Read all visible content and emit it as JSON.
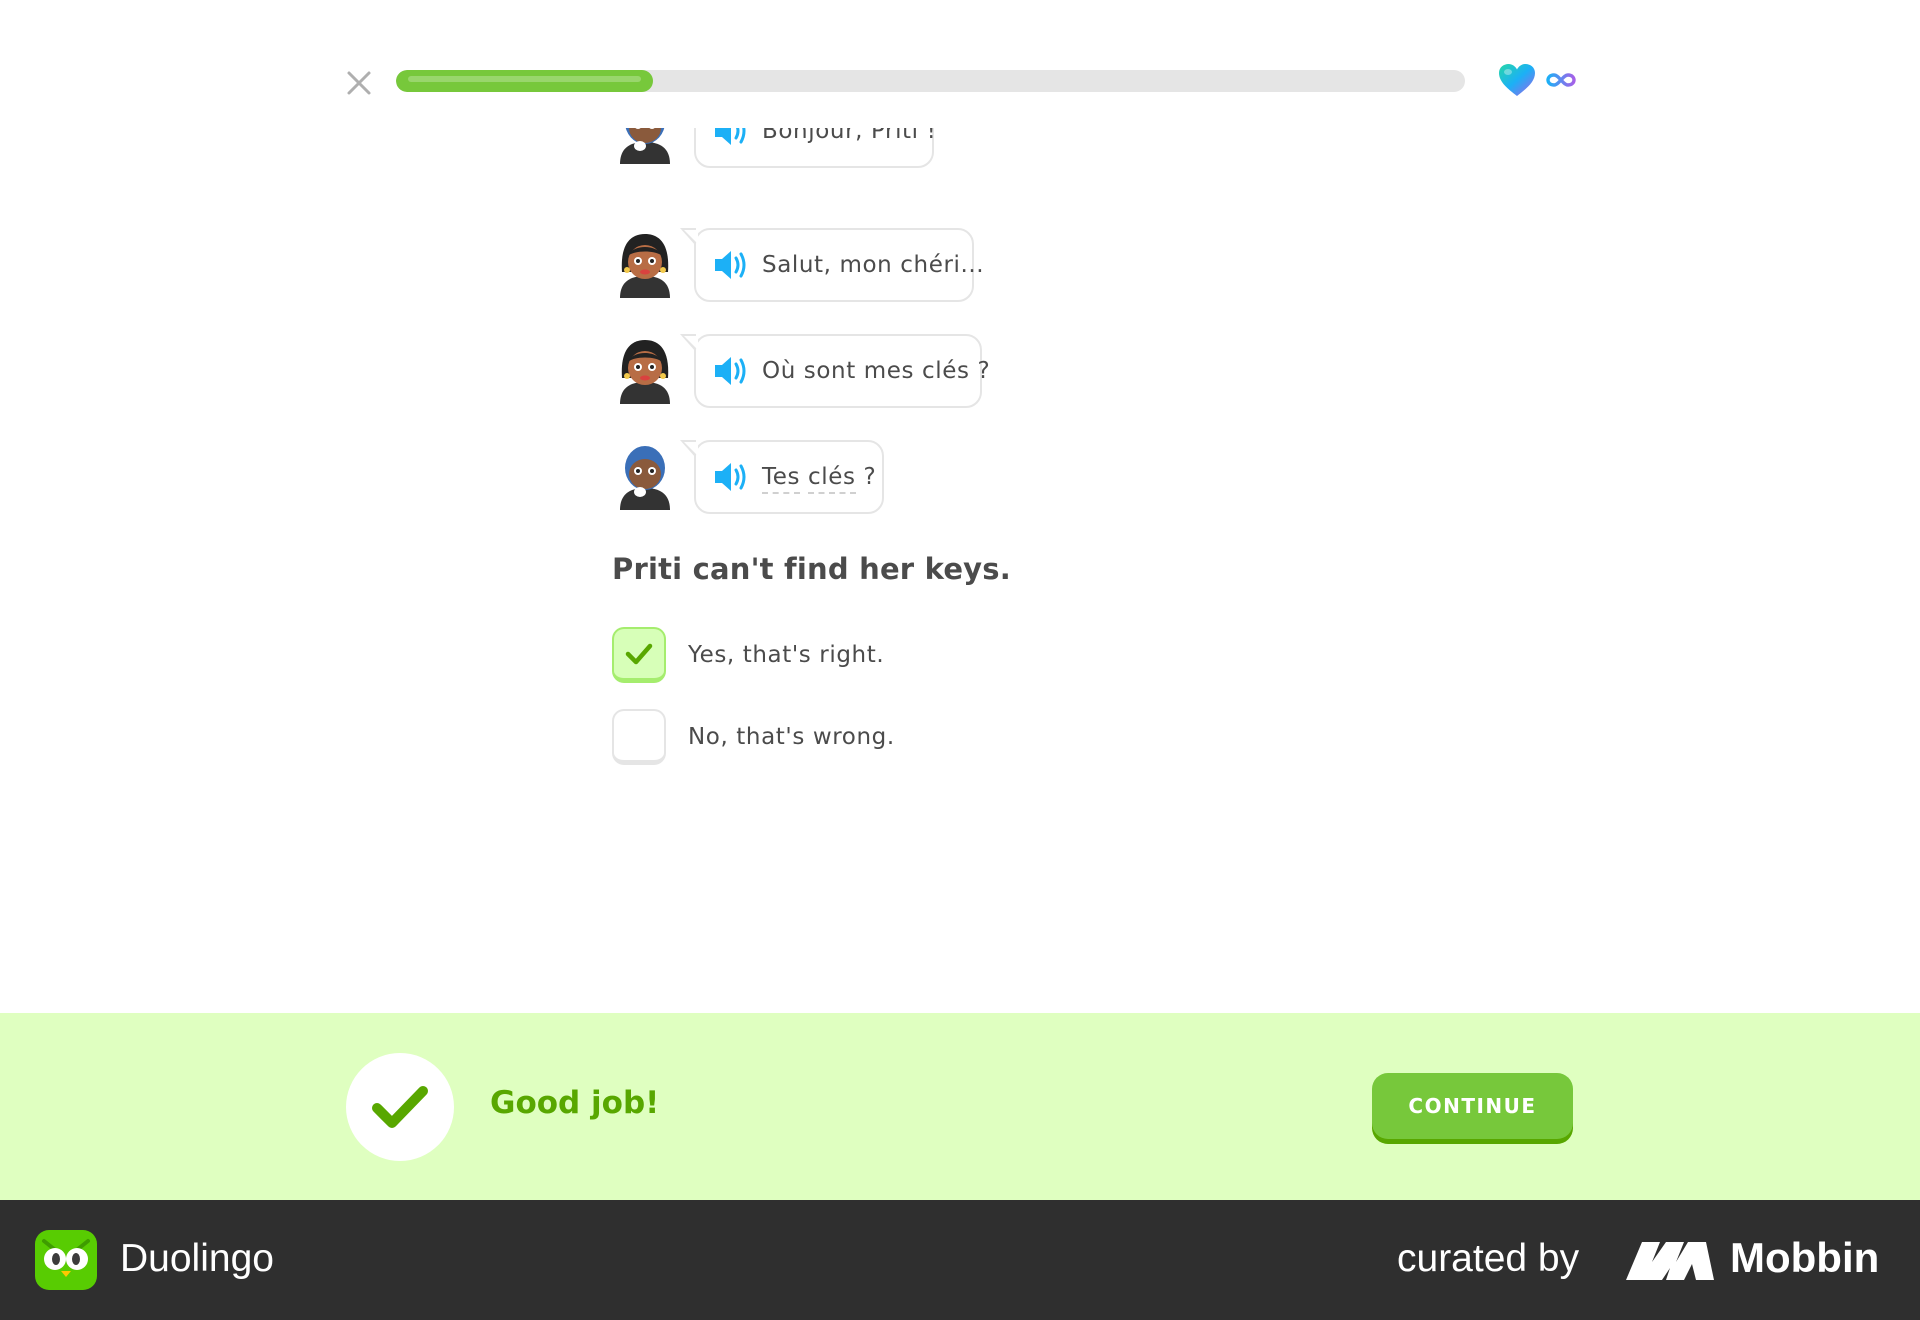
{
  "header": {
    "close_icon": "close-icon",
    "progress": 0.24,
    "hearts_icon": "heart-icon",
    "hearts_count_icon": "infinity-icon"
  },
  "dialogue": [
    {
      "speaker": "man",
      "text": "Bonjour, Priti !"
    },
    {
      "speaker": "priti",
      "text": "Salut, mon chéri..."
    },
    {
      "speaker": "priti",
      "text": "Où sont mes clés ?"
    },
    {
      "speaker": "man",
      "text_parts": [
        "Tes",
        "clés",
        "?"
      ]
    }
  ],
  "question": {
    "prompt": "Priti can't find her keys.",
    "options": [
      {
        "label": "Yes, that's right.",
        "checked": true
      },
      {
        "label": "No, that's wrong.",
        "checked": false
      }
    ]
  },
  "feedback": {
    "title": "Good job!",
    "continue_label": "CONTINUE",
    "colors": {
      "background": "#dfffc0",
      "accent": "#58a700",
      "button": "#77c83b"
    }
  },
  "banner": {
    "app_name": "Duolingo",
    "curated_label": "curated by",
    "brand_name": "Mobbin"
  }
}
